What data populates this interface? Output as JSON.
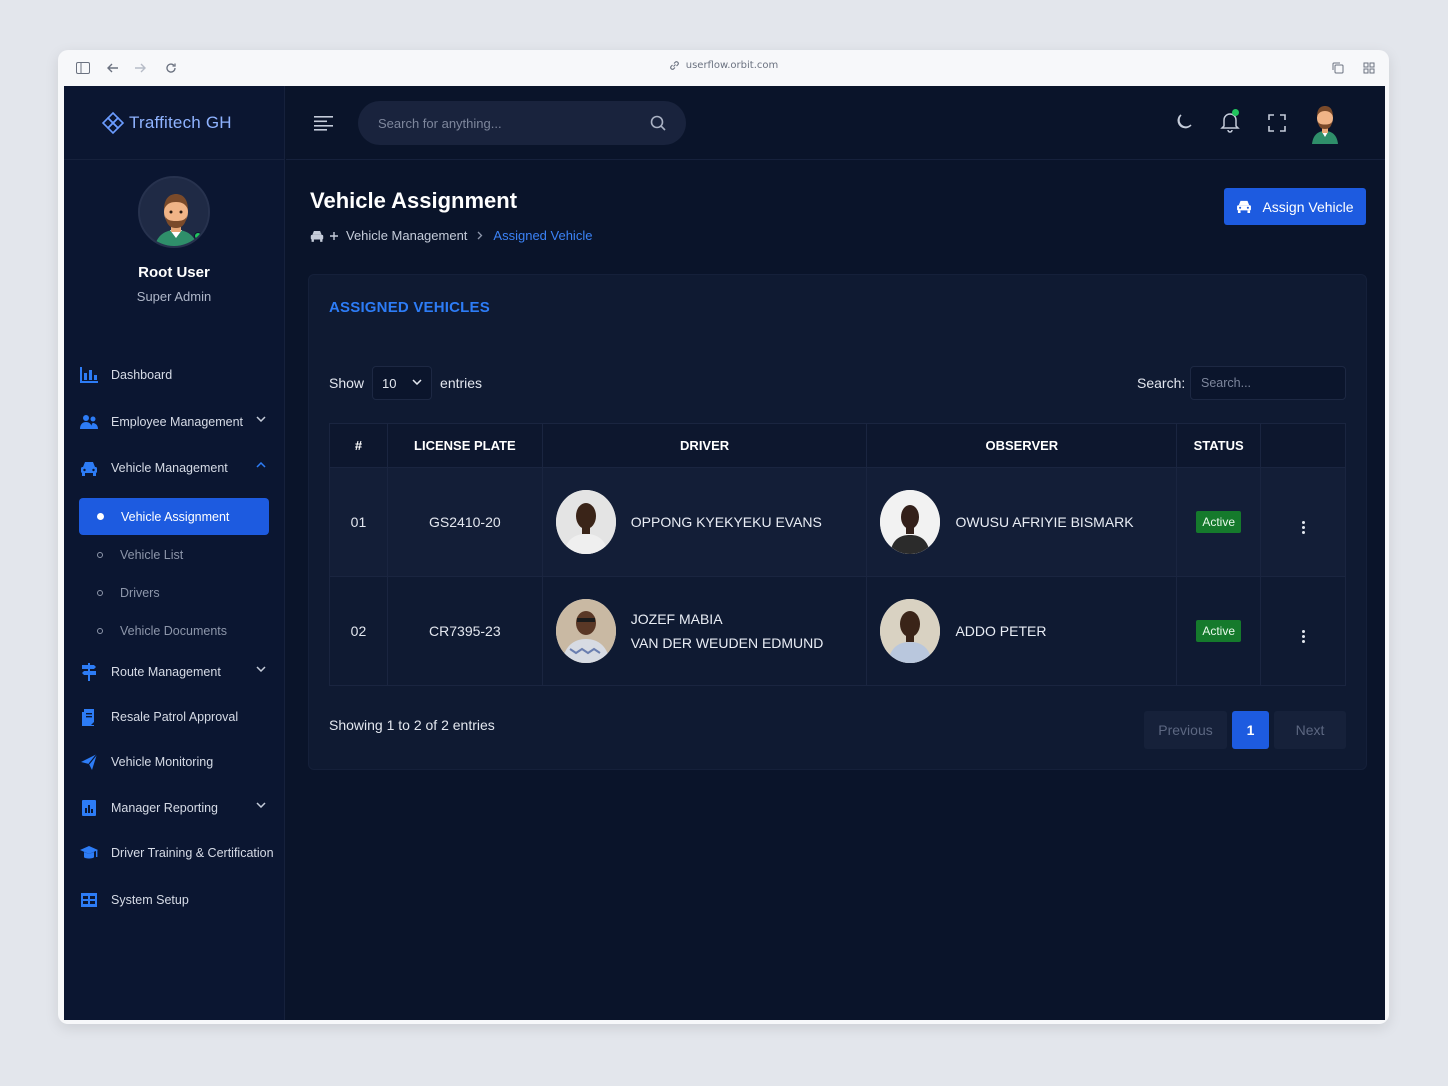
{
  "browser": {
    "url": "userflow.orbit.com"
  },
  "brand": {
    "name": "Traffitech GH"
  },
  "profile": {
    "name": "Root User",
    "role": "Super Admin"
  },
  "topbar": {
    "search_placeholder": "Search for anything..."
  },
  "sidebar": {
    "items": [
      {
        "label": "Dashboard",
        "icon": "chart-bar-icon"
      },
      {
        "label": "Employee Management",
        "icon": "users-icon"
      },
      {
        "label": "Vehicle Management",
        "icon": "car-icon"
      },
      {
        "label": "Route Management",
        "icon": "signpost-icon"
      },
      {
        "label": "Resale Patrol Approval",
        "icon": "clipboard-icon"
      },
      {
        "label": "Vehicle Monitoring",
        "icon": "monitor-send-icon"
      },
      {
        "label": "Manager Reporting",
        "icon": "report-icon"
      },
      {
        "label": "Driver Training & Certification",
        "icon": "graduation-cap-icon"
      },
      {
        "label": "System Setup",
        "icon": "table-icon"
      }
    ],
    "subitems": [
      {
        "label": "Vehicle Assignment"
      },
      {
        "label": "Vehicle List"
      },
      {
        "label": "Drivers"
      },
      {
        "label": "Vehicle Documents"
      }
    ]
  },
  "page": {
    "title": "Vehicle Assignment",
    "breadcrumb": {
      "parent": "Vehicle Management",
      "current": "Assigned Vehicle"
    },
    "assign_button": "Assign Vehicle"
  },
  "card": {
    "title": "ASSIGNED VEHICLES",
    "show_label": "Show",
    "entries_value": "10",
    "entries_label": "entries",
    "search_label": "Search:",
    "search_placeholder": "Search..."
  },
  "table": {
    "headers": [
      "#",
      "LICENSE PLATE",
      "DRIVER",
      "OBSERVER",
      "STATUS",
      ""
    ],
    "rows": [
      {
        "num": "01",
        "plate": "GS2410-20",
        "driver": "OPPONG KYEKYEKU EVANS",
        "driver_line2": "",
        "observer": "OWUSU AFRIYIE BISMARK",
        "status": "Active"
      },
      {
        "num": "02",
        "plate": "CR7395-23",
        "driver": "JOZEF MABIA",
        "driver_line2": "VAN DER WEUDEN EDMUND",
        "observer": "ADDO PETER",
        "status": "Active"
      }
    ]
  },
  "footer": {
    "info": "Showing 1 to 2 of 2 entries",
    "prev": "Previous",
    "page": "1",
    "next": "Next"
  },
  "colors": {
    "accent": "#1d5be0",
    "status_active": "#157a2c",
    "background": "#0a142a"
  }
}
